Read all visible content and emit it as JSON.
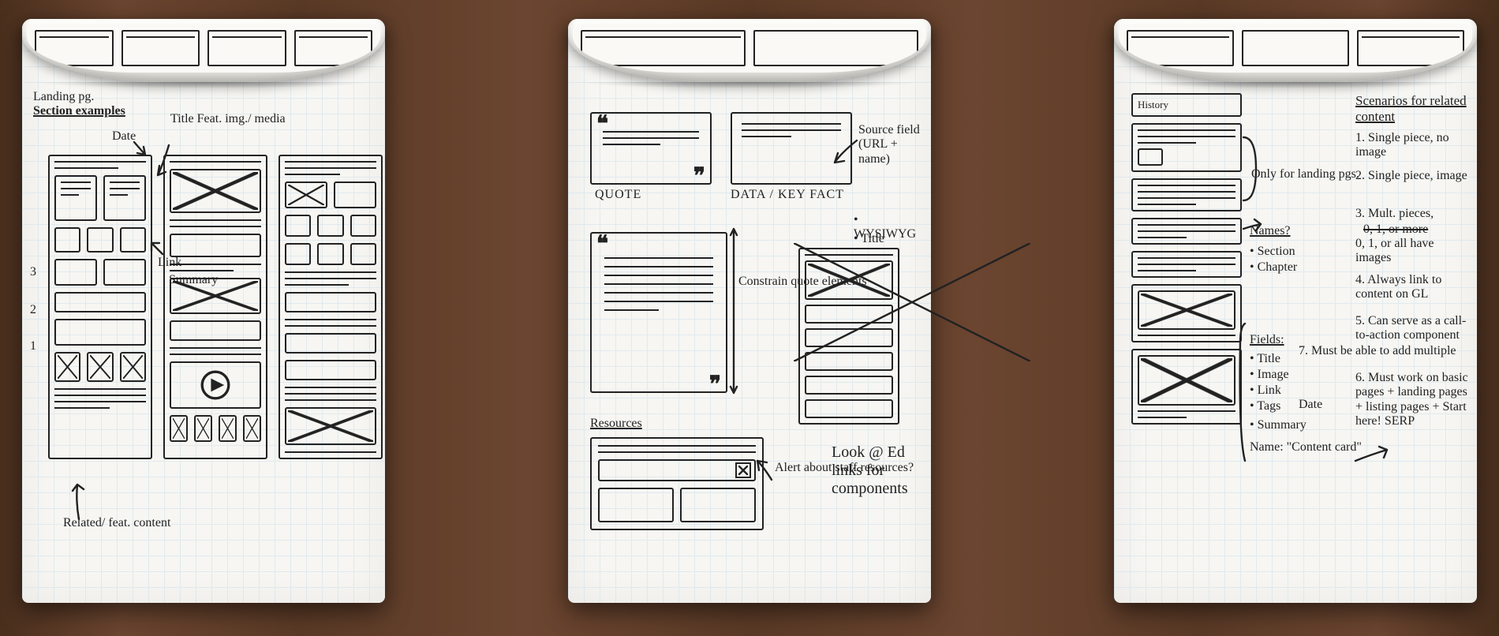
{
  "pad1": {
    "heading_small": "Landing pg.",
    "heading": "Section examples",
    "labels": {
      "date": "Date",
      "title_feat": "Title Feat.\nimg./\nmedia",
      "link": "Link",
      "summary": "Summary",
      "related": "Related/\nfeat.\ncontent"
    },
    "row_numbers": [
      "3",
      "2",
      "1"
    ]
  },
  "pad2": {
    "quote_label": "QUOTE",
    "data_label": "DATA / KEY FACT",
    "source_note": "Source\nfield\n(URL +\nname)",
    "extra_bullets": [
      "WYSIWYG",
      "Title"
    ],
    "constrain_note": "Constrain\nquote\nelements",
    "resources_heading": "Resources",
    "alert_note": "Alert\nabout\nstaff\nresources?",
    "look_note": "Look\n@ Ed links\nfor\ncomponents"
  },
  "pad3": {
    "history_label": "History",
    "only_note": "Only\nfor landing\npgs.",
    "names_heading": "Names?",
    "names_bullets": [
      "Section",
      "Chapter"
    ],
    "fields_heading": "Fields:",
    "fields_bullets": [
      "Title",
      "Image",
      "Link",
      "Tags",
      "Summary"
    ],
    "fields_note_7": "7. Must\nbe able to\nadd\nmultiple",
    "fields_date": "Date",
    "fields_name": "Name:\n\"Content card\"",
    "scenarios_heading": "Scenarios for\nrelated content",
    "scenarios": [
      "1. Single piece,\n   no image",
      "2. Single piece,\n   image",
      "3. Mult. pieces,",
      "0, 1, or more",
      "0, 1, or all have\n   images",
      "4. Always link to\n   content on GL",
      "5. Can serve as a\n   call-to-action\n   component",
      "6. Must work on\n   basic pages +\n   landing pages +\n   listing pages +\n   Start here! SERP"
    ]
  }
}
